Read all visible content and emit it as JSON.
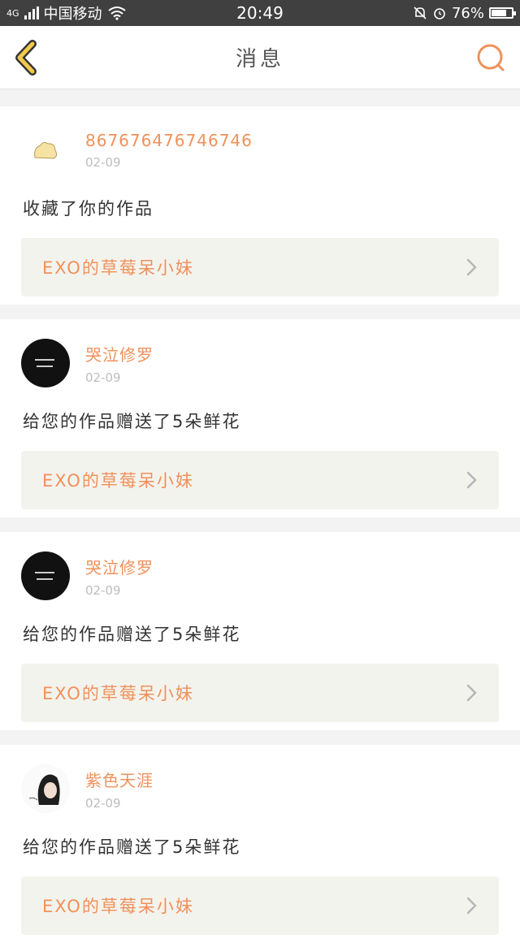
{
  "status_bar": {
    "network": "4G",
    "carrier": "中国移动",
    "time": "20:49",
    "battery": "76%",
    "battery_level": 0.76,
    "icons": [
      "signal-icon",
      "wifi-icon",
      "bell-muted-icon",
      "alarm-icon",
      "battery-icon"
    ]
  },
  "nav": {
    "title": "消息",
    "back_icon": "chevron-left-icon",
    "search_icon": "search-icon"
  },
  "colors": {
    "accent": "#f0915a",
    "back_icon": "#f2c94c",
    "card_bg": "#ffffff",
    "page_bg": "#f3f3f3",
    "work_bg": "#f3f3ee"
  },
  "messages": [
    {
      "user": "867676476746746",
      "date": "02-09",
      "action": "收藏了你的作品",
      "work": "EXO的草莓呆小妹",
      "avatar": "sticker"
    },
    {
      "user": "哭泣修罗",
      "date": "02-09",
      "action": "给您的作品赠送了5朵鲜花",
      "work": "EXO的草莓呆小妹",
      "avatar": "dark"
    },
    {
      "user": "哭泣修罗",
      "date": "02-09",
      "action": "给您的作品赠送了5朵鲜花",
      "work": "EXO的草莓呆小妹",
      "avatar": "dark"
    },
    {
      "user": "紫色天涯",
      "date": "02-09",
      "action": "给您的作品赠送了5朵鲜花",
      "work": "EXO的草莓呆小妹",
      "avatar": "portrait"
    }
  ]
}
